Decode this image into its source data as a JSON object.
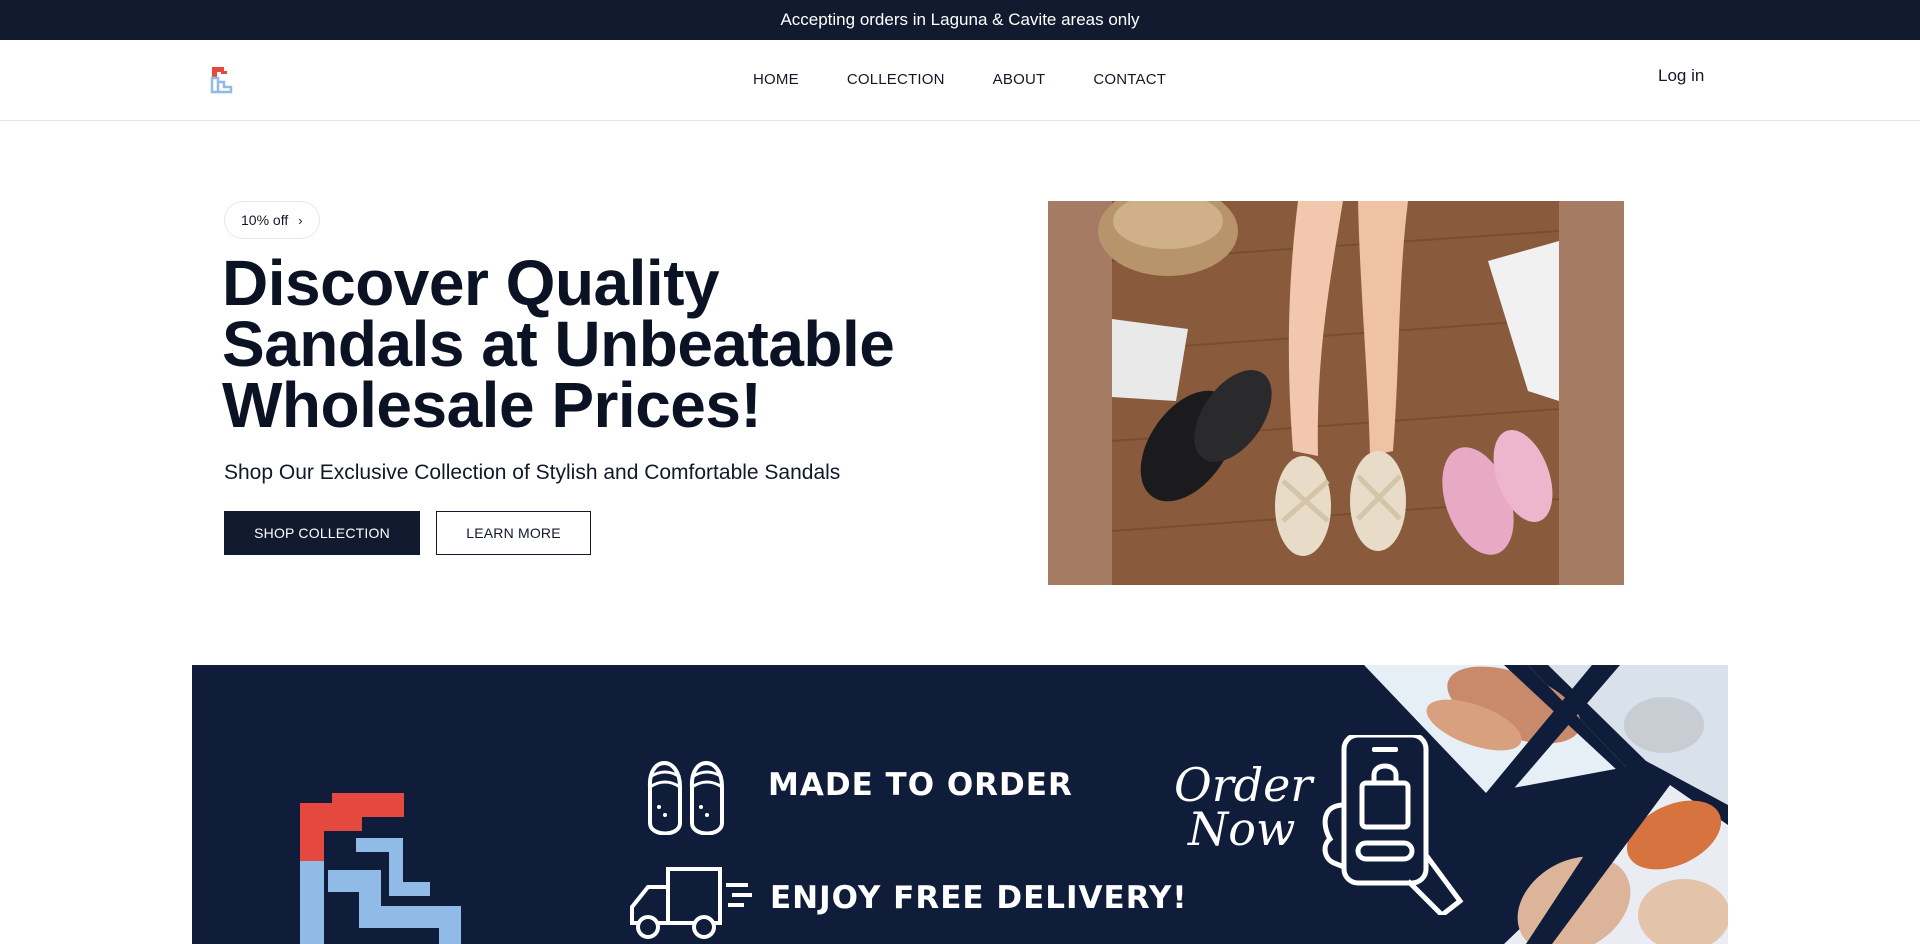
{
  "announcement": "Accepting orders in Laguna & Cavite areas only",
  "nav": {
    "home": "HOME",
    "collection": "COLLECTION",
    "about": "ABOUT",
    "contact": "CONTACT",
    "login": "Log in"
  },
  "hero": {
    "badge": "10% off",
    "badge_chevron": "›",
    "title_line1": "Discover Quality",
    "title_line2": "Sandals at Unbeatable",
    "title_line3": "Wholesale Prices!",
    "subtitle": "Shop Our Exclusive Collection of Stylish and Comfortable Sandals",
    "primary_button": "SHOP COLLECTION",
    "secondary_button": "LEARN MORE"
  },
  "banner": {
    "made_to_order": "MADE TO ORDER",
    "free_delivery": "ENJOY FREE DELIVERY!",
    "order_now_line1": "Order",
    "order_now_line2": "Now"
  },
  "colors": {
    "navy": "#111a2e",
    "banner_navy": "#0f1d3a",
    "logo_red": "#e5483e",
    "logo_blue": "#8fbbe6",
    "image_bg": "#a57b63"
  },
  "icons": [
    "logo-icon",
    "chevron-right-icon",
    "slippers-icon",
    "delivery-truck-icon",
    "phone-shopping-bag-icon"
  ]
}
